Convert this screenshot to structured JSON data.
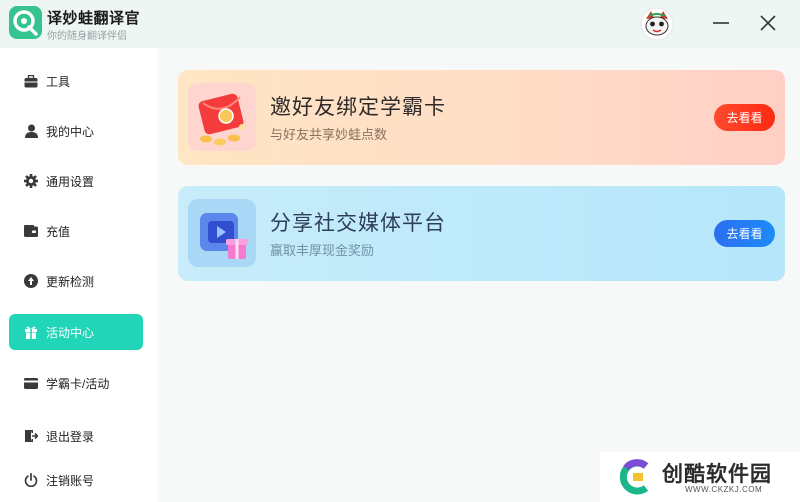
{
  "app": {
    "name": "译妙蛙翻译官",
    "subtitle": "你的随身翻译伴侣"
  },
  "sidebar": {
    "items": [
      {
        "label": "工具",
        "icon": "toolbox-icon"
      },
      {
        "label": "我的中心",
        "icon": "user-icon"
      },
      {
        "label": "通用设置",
        "icon": "gear-icon"
      },
      {
        "label": "充值",
        "icon": "wallet-icon"
      },
      {
        "label": "更新检测",
        "icon": "update-icon"
      },
      {
        "label": "活动中心",
        "icon": "gift-icon",
        "active": true
      },
      {
        "label": "学霸卡/活动",
        "icon": "card-icon"
      },
      {
        "label": "退出登录",
        "icon": "logout-icon"
      },
      {
        "label": "注销账号",
        "icon": "power-icon"
      }
    ]
  },
  "cards": [
    {
      "title": "邀好友绑定学霸卡",
      "desc": "与好友共享妙蛙点数",
      "button": "去看看",
      "accent": "#ff3a1e"
    },
    {
      "title": "分享社交媒体平台",
      "desc": "赢取丰厚现金奖励",
      "button": "去看看",
      "accent": "#2a74f3"
    }
  ],
  "watermark": {
    "name": "创酷软件园",
    "url": "WWW.CKZKJ.COM"
  },
  "colors": {
    "active_nav": "#20d5b8",
    "titlebar_bg": "#eef6f4"
  }
}
